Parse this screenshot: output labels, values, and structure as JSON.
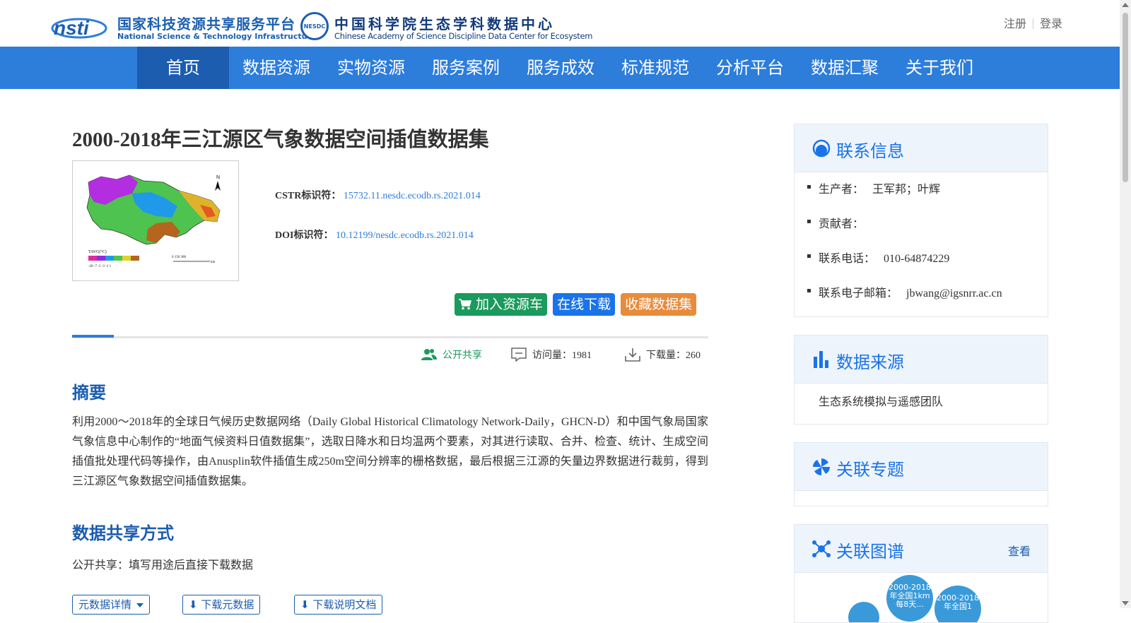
{
  "header": {
    "logo1": {
      "cn": "国家科技资源共享服务平台",
      "en": "National Science & Technology Infrastructure",
      "mark": "nsti"
    },
    "logo2": {
      "badge": "NESDC",
      "cn": "中国科学院生态学科数据中心",
      "en": "Chinese Academy of Science Discipline Data Center for Ecosystem"
    },
    "auth": {
      "register": "注册",
      "login": "登录"
    }
  },
  "nav": {
    "items": [
      "首页",
      "数据资源",
      "实物资源",
      "服务案例",
      "服务成效",
      "标准规范",
      "分析平台",
      "数据汇聚",
      "关于我们"
    ],
    "active": 0
  },
  "dataset": {
    "title": "2000-2018年三江源区气象数据空间插值数据集",
    "cstr_label": "CSTR标识符：",
    "cstr": "15732.11.nesdc.ecodb.rs.2021.014",
    "doi_label": "DOI标识符：",
    "doi": "10.12199/nesdc.ecodb.rs.2021.014",
    "thumb": {
      "north": "N",
      "legend_title": "TAVG(°C)",
      "legend_ticks": "-20  -7  -5  -3  -1  1",
      "scale": "0    150    300",
      "scale_unit": "km"
    }
  },
  "actions": {
    "cart": "加入资源车",
    "download": "在线下载",
    "favorite": "收藏数据集"
  },
  "stats": {
    "share": "公开共享",
    "visits": "访问量：1981",
    "downloads": "下载量：260"
  },
  "abstract": {
    "heading": "摘要",
    "text": "利用2000～2018年的全球日气候历史数据网络（Daily Global Historical Climatology Network-Daily，GHCN-D）和中国气象局国家气象信息中心制作的“地面气候资料日值数据集”，选取日降水和日均温两个要素，对其进行读取、合并、检查、统计、生成空间插值批处理代码等操作，由Anusplin软件插值生成250m空间分辨率的栅格数据，最后根据三江源的矢量边界数据进行裁剪，得到三江源区气象数据空间插值数据集。"
  },
  "sharing": {
    "heading": "数据共享方式",
    "text": "公开共享：填写用途后直接下载数据",
    "buttons": [
      "元数据详情",
      "下载元数据",
      "下载说明文档"
    ]
  },
  "sidebar": {
    "contact": {
      "title": "联系信息",
      "items": [
        {
          "label": "生产者：",
          "value": "王军邦；叶辉"
        },
        {
          "label": "贡献者：",
          "value": ""
        },
        {
          "label": "联系电话：",
          "value": "010-64874229"
        },
        {
          "label": "联系电子邮箱：",
          "value": "jbwang@igsnrr.ac.cn"
        }
      ]
    },
    "source": {
      "title": "数据来源",
      "text": "生态系统模拟与遥感团队"
    },
    "topics": {
      "title": "关联专题"
    },
    "graph": {
      "title": "关联图谱",
      "more": "查看",
      "bubbles": [
        "2000-2018年全国1km每8天...",
        "2000-2018年全国1"
      ]
    }
  },
  "colors": {
    "nav": "#2d7ddb",
    "nav_active": "#1c5db0",
    "accent": "#1a73e8",
    "green": "#1a9a5c",
    "orange": "#e88b3b"
  }
}
